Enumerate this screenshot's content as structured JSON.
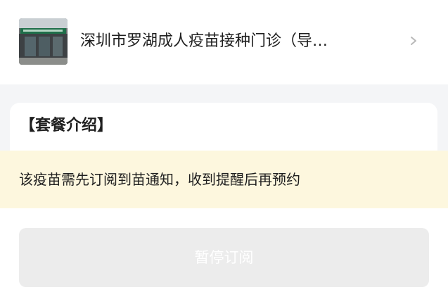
{
  "clinic": {
    "name": "深圳市罗湖成人疫苗接种门诊（导…"
  },
  "package": {
    "title": "【套餐介绍】"
  },
  "notice": {
    "text": "该疫苗需先订阅到苗通知，收到提醒后再预约"
  },
  "action": {
    "label": "暂停订阅",
    "state": "disabled"
  }
}
